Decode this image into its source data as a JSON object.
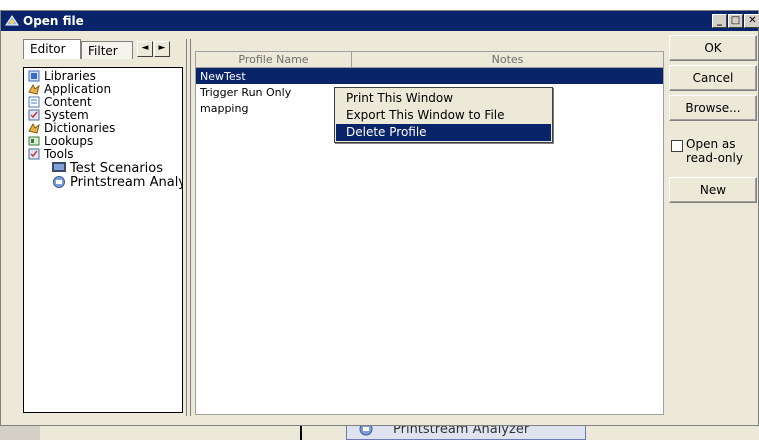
{
  "window": {
    "title": "Open file"
  },
  "tabs": {
    "editor": "Editor",
    "filter": "Filter",
    "left_arrow": "◄",
    "right_arrow": "►"
  },
  "tree": {
    "items": [
      {
        "label": "Libraries",
        "icon": "library-icon"
      },
      {
        "label": "Application",
        "icon": "application-icon"
      },
      {
        "label": "Content",
        "icon": "content-icon"
      },
      {
        "label": "System",
        "icon": "system-icon"
      },
      {
        "label": "Dictionaries",
        "icon": "dictionary-icon"
      },
      {
        "label": "Lookups",
        "icon": "lookup-icon"
      },
      {
        "label": "Tools",
        "icon": "tools-icon"
      },
      {
        "label": "Test Scenarios",
        "icon": "test-scenarios-icon",
        "selected": true
      },
      {
        "label": "Printstream Analy",
        "icon": "printstream-icon"
      }
    ]
  },
  "table": {
    "columns": [
      "Profile Name",
      "Notes"
    ],
    "rows": [
      {
        "name": "NewTest",
        "selected": true
      },
      {
        "name": "Trigger Run Only"
      },
      {
        "name": "mapping"
      }
    ]
  },
  "context_menu": {
    "items": [
      "Print This Window",
      "Export This Window to File",
      "Delete Profile"
    ],
    "highlighted_index": 2
  },
  "buttons": {
    "ok": "OK",
    "cancel": "Cancel",
    "browse": "Browse...",
    "new": "New"
  },
  "open_readonly": {
    "label": "Open as read-only",
    "checked": false
  },
  "background": {
    "item_label": "Printstream Analyzer"
  },
  "colors": {
    "title_bar": "#0a246a",
    "selection": "#0a246a",
    "dialog_bg": "#ece9d8"
  }
}
